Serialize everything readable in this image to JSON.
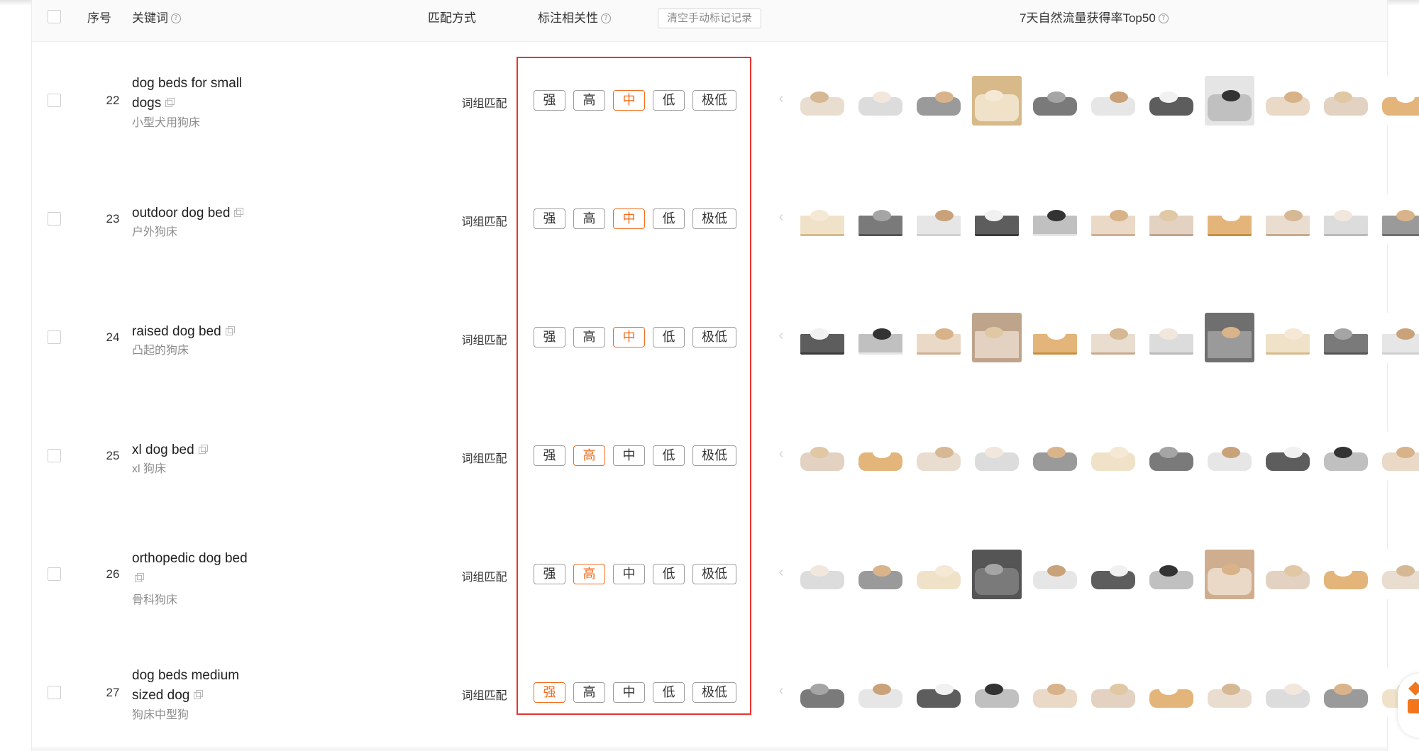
{
  "header": {
    "seq_label": "序号",
    "keyword_label": "关键词",
    "match_label": "匹配方式",
    "relevance_label": "标注相关性",
    "clear_button": "清空手动标记记录",
    "rate_label": "7天自然流量获得率Top50",
    "help_icon": "question-circle-icon"
  },
  "tag_labels": [
    "强",
    "高",
    "中",
    "低",
    "极低"
  ],
  "colors": {
    "accent_orange": "#f26b1d",
    "highlight_red_box": "#e8342f",
    "border_gray": "#9d9d9d"
  },
  "rows": [
    {
      "idx": "22",
      "kw_line1": "dog beds for small",
      "kw_line2": "dogs",
      "cn": "小型犬用狗床",
      "match": "词组匹配",
      "selected": "中"
    },
    {
      "idx": "23",
      "kw_line1": "outdoor dog bed",
      "kw_line2": "",
      "cn": "户外狗床",
      "match": "词组匹配",
      "selected": "中"
    },
    {
      "idx": "24",
      "kw_line1": "raised dog bed",
      "kw_line2": "",
      "cn": "凸起的狗床",
      "match": "词组匹配",
      "selected": "中"
    },
    {
      "idx": "25",
      "kw_line1": "xl dog bed",
      "kw_line2": "",
      "cn": "xl 狗床",
      "match": "词组匹配",
      "selected": "高"
    },
    {
      "idx": "26",
      "kw_line1": "orthopedic dog bed",
      "kw_line2": "",
      "cn": "骨科狗床",
      "match": "词组匹配",
      "selected": "高"
    },
    {
      "idx": "27",
      "kw_line1": "dog beds medium",
      "kw_line2": "sized dog",
      "cn": "狗床中型狗",
      "match": "词组匹配",
      "selected": "强"
    }
  ]
}
